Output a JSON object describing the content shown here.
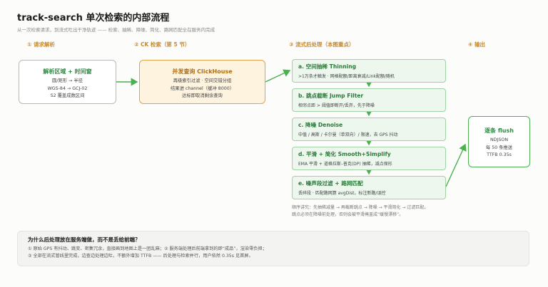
{
  "title": "track-search 单次检索的内部流程",
  "subtitle": "从一次检索请求，到流式吐出干净轨迹 —— 检索、抽稀、降噪、简化、路网匹配全在服务内完成",
  "stages": [
    {
      "label": "① 请求解析"
    },
    {
      "label": "② CK 检索（第 5 节）"
    },
    {
      "label": "③ 流式后处理（本图重点）"
    },
    {
      "label": "④ 输出"
    }
  ],
  "parse_box": {
    "title": "解析区域 + 时间窗",
    "lines": [
      "圆/矩形 → 半径",
      "WGS-84 → GCJ-02",
      "S2 覆盖成数区间"
    ]
  },
  "ck_box": {
    "title": "并发查询 ClickHouse",
    "lines": [
      "再级索引过滤 · 空间交错分组",
      "结果进 channel（缓冲 8000）",
      "达标即取消剩余查询"
    ]
  },
  "steps": [
    {
      "title": "a. 空间抽稀 Thinning",
      "desc": ">1万条才触发 · 网格配额/距离衰减/Link配额/随机"
    },
    {
      "title": "b. 跳点截断 Jump Filter",
      "desc": "相邻点距 > 阈值即断开/丢弃，先于降噪"
    },
    {
      "title": "c. 降噪 Denoise",
      "desc": "中值 / 高斯 / 卡尔曼（单双向）/ 限速，去 GPS 抖动"
    },
    {
      "title": "d. 平滑 + 简化 Smooth+Simplify",
      "desc": "EMA 平滑 + 道格拉斯–普克(DP) 抽稀，减点保形"
    },
    {
      "title": "e. 噪声段过滤 + 路网匹配",
      "desc": "丢碎段 · 匹配路网算 avgDist，标注新路/误控"
    }
  ],
  "order_note": [
    "顺序讲究：先抽稀减量 → 再截断跳点 → 降噪 → 平滑简化 → 过滤匹配。",
    "跳点必须在降噪前处理，否则会被平滑掩盖成“缓慢漂移”。"
  ],
  "flush_box": {
    "title": "逐条 flush",
    "lines": [
      "NDJSON",
      "每 50 条推送",
      "TTFB 0.35s"
    ]
  },
  "why": {
    "title": "为什么后处理放在服务端做，而不是丢给前端？",
    "lines": [
      "① 原始 GPS 有抖动、跳变、密集冗余，直接画到地图上是一团乱麻；② 服务端处理后前端拿到的即“成品”，渲染零负担；",
      "③ 全部在流式管线里完成，边查边处理边吐，不额外增加 TTFB —— 后处理与检索并行，用户依然 0.35s 见首屏。"
    ]
  },
  "colors": {
    "green": "#4caf50",
    "orange": "#e0a34c",
    "stage_label": "#c98a2a"
  }
}
